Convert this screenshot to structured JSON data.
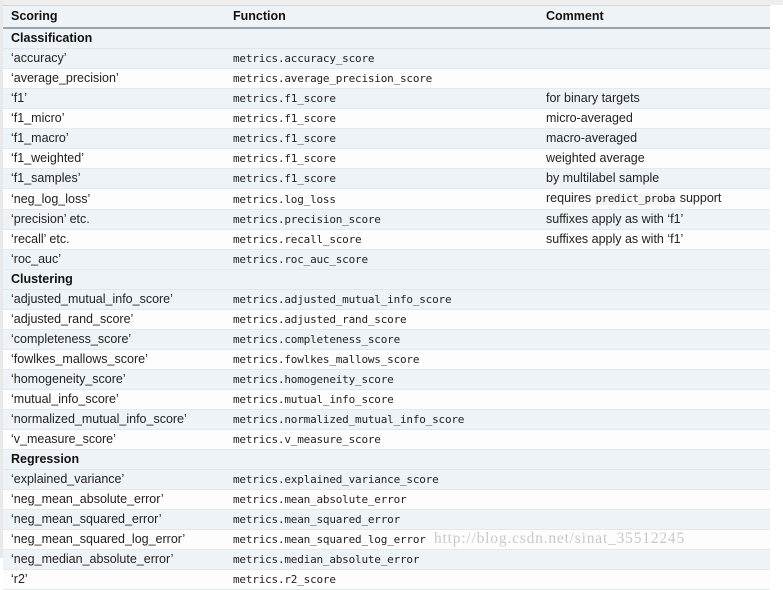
{
  "table": {
    "columns": [
      "Scoring",
      "Function",
      "Comment"
    ],
    "rows": [
      {
        "type": "section",
        "scoring": "Classification",
        "function": "",
        "comment": ""
      },
      {
        "type": "data",
        "scoring": "‘accuracy’",
        "function": "metrics.accuracy_score",
        "comment": ""
      },
      {
        "type": "data",
        "scoring": "‘average_precision’",
        "function": "metrics.average_precision_score",
        "comment": ""
      },
      {
        "type": "data",
        "scoring": "‘f1’",
        "function": "metrics.f1_score",
        "comment": "for binary targets"
      },
      {
        "type": "data",
        "scoring": "‘f1_micro’",
        "function": "metrics.f1_score",
        "comment": "micro-averaged"
      },
      {
        "type": "data",
        "scoring": "‘f1_macro’",
        "function": "metrics.f1_score",
        "comment": "macro-averaged"
      },
      {
        "type": "data",
        "scoring": "‘f1_weighted’",
        "function": "metrics.f1_score",
        "comment": "weighted average"
      },
      {
        "type": "data",
        "scoring": "‘f1_samples’",
        "function": "metrics.f1_score",
        "comment": "by multilabel sample"
      },
      {
        "type": "data",
        "scoring": "‘neg_log_loss’",
        "function": "metrics.log_loss",
        "comment": "requires ",
        "comment_code": "predict_proba",
        "comment_after": " support"
      },
      {
        "type": "data",
        "scoring": "‘precision’ etc.",
        "function": "metrics.precision_score",
        "comment": "suffixes apply as with ‘f1’"
      },
      {
        "type": "data",
        "scoring": "‘recall’ etc.",
        "function": "metrics.recall_score",
        "comment": "suffixes apply as with ‘f1’"
      },
      {
        "type": "data",
        "scoring": "‘roc_auc’",
        "function": "metrics.roc_auc_score",
        "comment": ""
      },
      {
        "type": "section",
        "scoring": "Clustering",
        "function": "",
        "comment": ""
      },
      {
        "type": "data",
        "scoring": "‘adjusted_mutual_info_score’",
        "function": "metrics.adjusted_mutual_info_score",
        "comment": ""
      },
      {
        "type": "data",
        "scoring": "‘adjusted_rand_score’",
        "function": "metrics.adjusted_rand_score",
        "comment": ""
      },
      {
        "type": "data",
        "scoring": "‘completeness_score’",
        "function": "metrics.completeness_score",
        "comment": ""
      },
      {
        "type": "data",
        "scoring": "‘fowlkes_mallows_score’",
        "function": "metrics.fowlkes_mallows_score",
        "comment": ""
      },
      {
        "type": "data",
        "scoring": "‘homogeneity_score’",
        "function": "metrics.homogeneity_score",
        "comment": ""
      },
      {
        "type": "data",
        "scoring": "‘mutual_info_score’",
        "function": "metrics.mutual_info_score",
        "comment": ""
      },
      {
        "type": "data",
        "scoring": "‘normalized_mutual_info_score’",
        "function": "metrics.normalized_mutual_info_score",
        "comment": ""
      },
      {
        "type": "data",
        "scoring": "‘v_measure_score’",
        "function": "metrics.v_measure_score",
        "comment": ""
      },
      {
        "type": "section",
        "scoring": "Regression",
        "function": "",
        "comment": ""
      },
      {
        "type": "data",
        "scoring": "‘explained_variance’",
        "function": "metrics.explained_variance_score",
        "comment": ""
      },
      {
        "type": "data",
        "scoring": "‘neg_mean_absolute_error’",
        "function": "metrics.mean_absolute_error",
        "comment": ""
      },
      {
        "type": "data",
        "scoring": "‘neg_mean_squared_error’",
        "function": "metrics.mean_squared_error",
        "comment": ""
      },
      {
        "type": "data",
        "scoring": "‘neg_mean_squared_log_error’",
        "function": "metrics.mean_squared_log_error",
        "comment": ""
      },
      {
        "type": "data",
        "scoring": "‘neg_median_absolute_error’",
        "function": "metrics.median_absolute_error",
        "comment": ""
      },
      {
        "type": "data",
        "scoring": "‘r2’",
        "function": "metrics.r2_score",
        "comment": ""
      }
    ]
  },
  "watermark": {
    "text": "http://blog.csdn.net/sinat_35512245"
  },
  "colors": {
    "row_shaded": "#eef3f8",
    "row_plain": "#fdfdfd",
    "code_blue": "#2f6b9a",
    "header_rule": "#9aa2aa",
    "watermark": "#c9c9c9"
  }
}
